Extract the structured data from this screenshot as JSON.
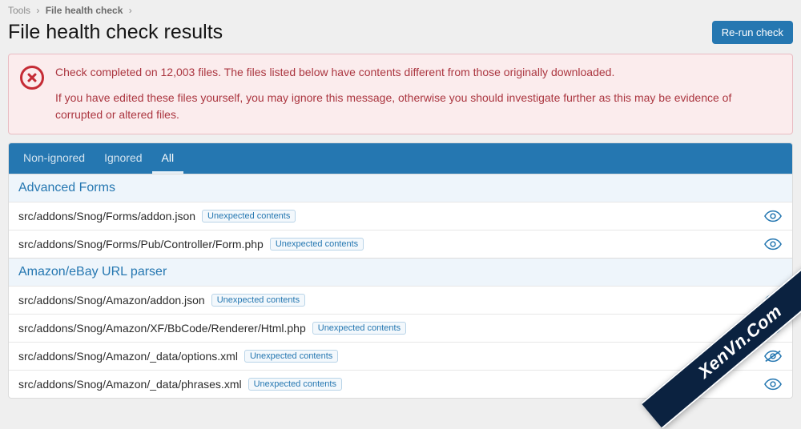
{
  "breadcrumb": {
    "tools": "Tools",
    "page": "File health check"
  },
  "title": "File health check results",
  "rerun_btn": "Re-run check",
  "alert": {
    "line1": "Check completed on 12,003 files. The files listed below have contents different from those originally downloaded.",
    "line2": "If you have edited these files yourself, you may ignore this message, otherwise you should investigate further as this may be evidence of corrupted or altered files."
  },
  "tabs": {
    "non_ignored": "Non-ignored",
    "ignored": "Ignored",
    "all": "All"
  },
  "sections": [
    {
      "header": "Advanced Forms",
      "files": [
        {
          "path": "src/addons/Snog/Forms/addon.json",
          "status": "Unexpected contents",
          "ignored": false
        },
        {
          "path": "src/addons/Snog/Forms/Pub/Controller/Form.php",
          "status": "Unexpected contents",
          "ignored": false
        }
      ]
    },
    {
      "header": "Amazon/eBay URL parser",
      "files": [
        {
          "path": "src/addons/Snog/Amazon/addon.json",
          "status": "Unexpected contents",
          "ignored": false
        },
        {
          "path": "src/addons/Snog/Amazon/XF/BbCode/Renderer/Html.php",
          "status": "Unexpected contents",
          "ignored": false
        },
        {
          "path": "src/addons/Snog/Amazon/_data/options.xml",
          "status": "Unexpected contents",
          "ignored": true
        },
        {
          "path": "src/addons/Snog/Amazon/_data/phrases.xml",
          "status": "Unexpected contents",
          "ignored": false
        }
      ]
    }
  ],
  "watermark": "XenVn.Com"
}
